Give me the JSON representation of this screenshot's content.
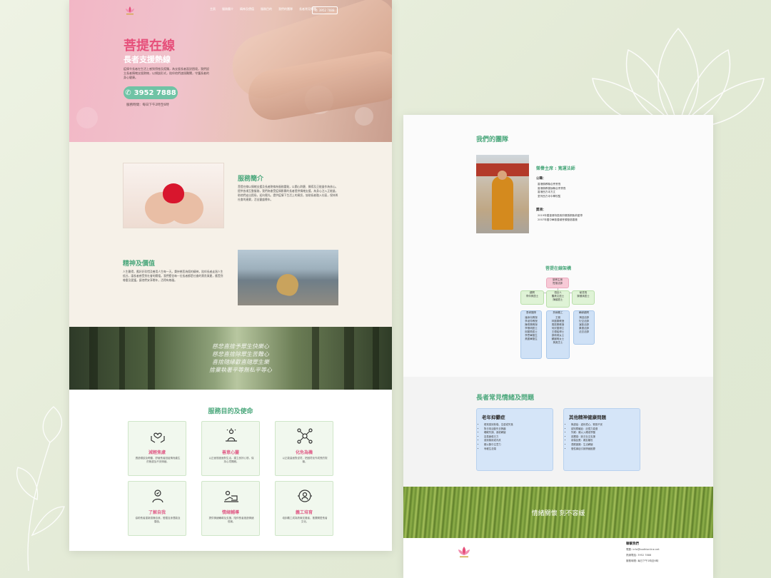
{
  "nav": {
    "items": [
      "主頁",
      "服務簡介",
      "精神及價值",
      "服務目的",
      "我們的團隊",
      "長者常見問題"
    ],
    "phone": "3952 7888"
  },
  "hero": {
    "title": "菩提在線",
    "subtitle": "長者支援熱線",
    "desc": "疫情令長者在生活上感到徬徨及孤獨，為支援長者面對困境，我們設立長者情緒支援熱線，以傾談形式，陪伴他們渡過難關，守護長者的身心健康。",
    "phone": "3952 7888",
    "hours": "服務時間：每日下午2時至6時"
  },
  "intro": {
    "title": "服務簡介",
    "body": "菩提在線以情緒支援及長者熱線為服務重點，以關心聆聽、開導及正能量作為核心。提供各項互動服務，我們為會受疫情影響的長者提供情緒支援。為身心注入正能量，助他們走出困局，迎向陽光。提供疫情下生活上的資訊，協助長者融入社區，保持與社會的連繫，活出豐盛晚年。",
    "value_title": "精神及價值",
    "value_body": "人生難得，應好好珍惜及善用人生每一天。秉持慈悲為懷的精神，陪伴長者走過人生低谷，讓長者感受到社會的關懷。我們堅信每一位長者都是社會的寶貴資產，應受到尊重及愛護，讓他們安享晚年，活得有尊嚴。"
  },
  "forest": {
    "lines": [
      "慈悲喜捨予眾生快樂心",
      "慈悲喜捨除眾生苦難心",
      "喜捨隨緣歡喜隨眾生樂",
      "捨棄執著平等無私平等心"
    ]
  },
  "mission": {
    "title": "服務目的及使命",
    "cards": [
      {
        "title": "減輕焦慮",
        "desc": "透過傾談及聆聽，舒緩長者因疫情而產生的焦慮及不安情緒。"
      },
      {
        "title": "善意心靈",
        "desc": "以正面態度面對生活，建立良好心態，保持心境開朗。"
      },
      {
        "title": "化危為機",
        "desc": "以正能量面對逆境，把困境化作成長的契機。"
      },
      {
        "title": "了解自我",
        "desc": "協助長者重新認識自我，發掘自身潛能及價值。"
      },
      {
        "title": "情緒輔導",
        "desc": "提供情緒輔導及支援，陪伴長者渡過情緒低潮。"
      },
      {
        "title": "義工培育",
        "desc": "培訓義工成為熱線支援者，推廣關愛長者文化。"
      }
    ]
  },
  "team": {
    "title": "我們的團隊",
    "name": "榮譽主席 : 寬運法師",
    "h1": "公職：",
    "duties": [
      "香港佛教聯合會會長",
      "香港佛教僧伽聯合會會長",
      "香港西方寺方丈",
      "荃灣西方寺中學校監"
    ],
    "h2": "獎項：",
    "awards": [
      "2019年獲香港特區政府頒授銅紫荊星章",
      "2007年獲中華慈善總會頒發慈善獎"
    ]
  },
  "org": {
    "title": "菩提在線架構",
    "top": "榮譽主席\n寬運法師",
    "mid": [
      "顧問\n李仲黃居士",
      "項目人\n羅黃文居士\n陳穎居士",
      "秘書長\n黎儷清居士"
    ],
    "bottom": [
      {
        "head": "督導團隊",
        "body": "潘添光教授\n李淑芳教授\n陳偉業教授\n李雪明居士\n邱麗瓊居士\n李思華醫生\n黃麗華醫生"
      },
      {
        "head": "熱線義工",
        "body": "王雅\n林麗雲教授\n周振業教授\n何欣蘭博士\n王德銘博士\n鄭莉琪女士\n蘇國明女士\n黃鳳芝士"
      },
      {
        "head": "輔導顧問",
        "body": "淨因法師\n衍空法師\n演慈法師\n果德法師\n法忍法師"
      }
    ]
  },
  "issues": {
    "title": "長者常見情緒及問題",
    "card1_title": "老年抑鬱症",
    "card1_items": [
      "經常感到悲傷、空虛或失落",
      "對日常活動失去興趣",
      "睡眠失調、食慾轉變",
      "容易疲倦乏力",
      "感到無用或內疚",
      "難以集中注意力",
      "有輕生念頭"
    ],
    "card2_title": "其他精神健康問題",
    "card2_items": [
      "焦慮症：過份擔心、緊張不安",
      "認知障礙症：記憶力衰退",
      "失眠：難以入睡或早醒",
      "孤獨感：缺乏社交支援",
      "哀傷反應：親友離世",
      "適應困難：生活轉變",
      "慢性痛症引致情緒困擾"
    ]
  },
  "grass": {
    "text": "情緒關懷 刻不容緩"
  },
  "footer": {
    "heading": "聯繫我們",
    "email": "電郵: info@bodhionline.net",
    "phone": "熱線電話: 3952 7888",
    "hours": "服務時間: 每日下午2時至6時"
  },
  "colors": {
    "brand_green": "#4aa77b",
    "brand_pink": "#e64f7a",
    "phone_button": "#6fc3a5"
  }
}
